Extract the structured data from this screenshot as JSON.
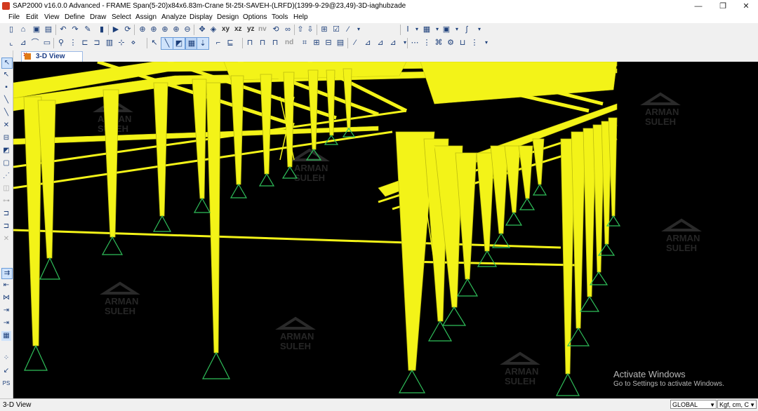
{
  "window": {
    "title": "SAP2000 v16.0.0 Advanced  - FRAME Span(5-20)x84x6.83m-Crane 5t-25t-SAVEH-(LRFD)(1399-9-29@23,49)-3D-iaghubzade",
    "minimize_glyph": "—",
    "maximize_glyph": "❐",
    "close_glyph": "✕"
  },
  "menu": [
    "File",
    "Edit",
    "View",
    "Define",
    "Draw",
    "Select",
    "Assign",
    "Analyze",
    "Display",
    "Design",
    "Options",
    "Tools",
    "Help"
  ],
  "toolbar1": {
    "view_buttons": [
      "xy",
      "xz",
      "yz",
      "nv"
    ]
  },
  "toolbar2": {
    "nd_label": "nd"
  },
  "tab": {
    "close_glyph": "×",
    "label": "3-D View"
  },
  "watermark": {
    "line1": "ARMAN",
    "line2": "SULEH"
  },
  "activation": {
    "title": "Activate Windows",
    "subtitle": "Go to Settings to activate Windows."
  },
  "status": {
    "text": "3-D View",
    "coord_system": "GLOBAL",
    "units": "Kgf, cm, C"
  },
  "colors": {
    "frame_yellow": "#f3f318",
    "support_green": "#2fbf5a",
    "viewport_bg": "#000000"
  },
  "icons": {
    "window": "sap-app-icon",
    "tab": "3d-view-icon"
  }
}
